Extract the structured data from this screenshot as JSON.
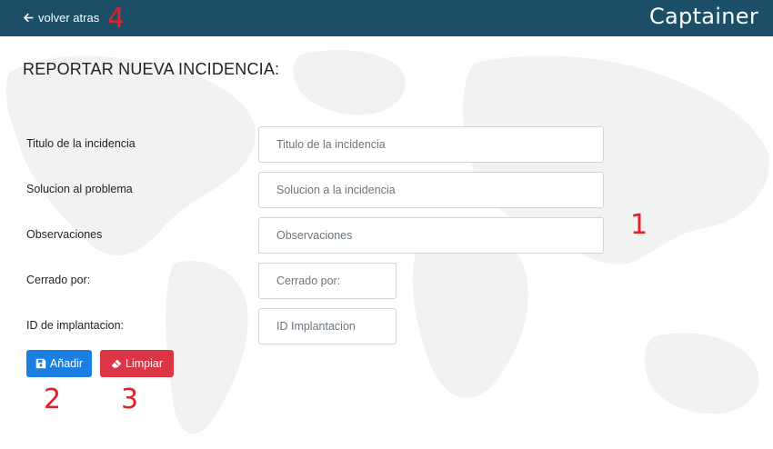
{
  "header": {
    "back_label": "volver atras",
    "brand": "Captainer",
    "background_color": "#1b4f67"
  },
  "page_title": "REPORTAR NUEVA INCIDENCIA:",
  "form": {
    "fields": [
      {
        "label": "Titulo de la incidencia",
        "placeholder": "Titulo de la incidencia",
        "value": ""
      },
      {
        "label": "Solucion al problema",
        "placeholder": "Solucion a la incidencia",
        "value": ""
      },
      {
        "label": "Observaciones",
        "placeholder": "Observaciones",
        "value": ""
      },
      {
        "label": "Cerrado por:",
        "placeholder": "Cerrado por:",
        "value": ""
      },
      {
        "label": "ID de implantacion:",
        "placeholder": "ID Implantacion",
        "value": ""
      }
    ]
  },
  "buttons": {
    "add": {
      "label": "Añadir",
      "icon": "floppy-disk-icon",
      "color": "#1a7fe0"
    },
    "clear": {
      "label": "Limpiar",
      "icon": "eraser-icon",
      "color": "#dc3545"
    }
  },
  "annotations": {
    "one": "1",
    "two": "2",
    "three": "3",
    "four": "4",
    "color": "#e0202a"
  },
  "icons": {
    "back": "arrow-left-icon",
    "background": "world-map-icon"
  }
}
